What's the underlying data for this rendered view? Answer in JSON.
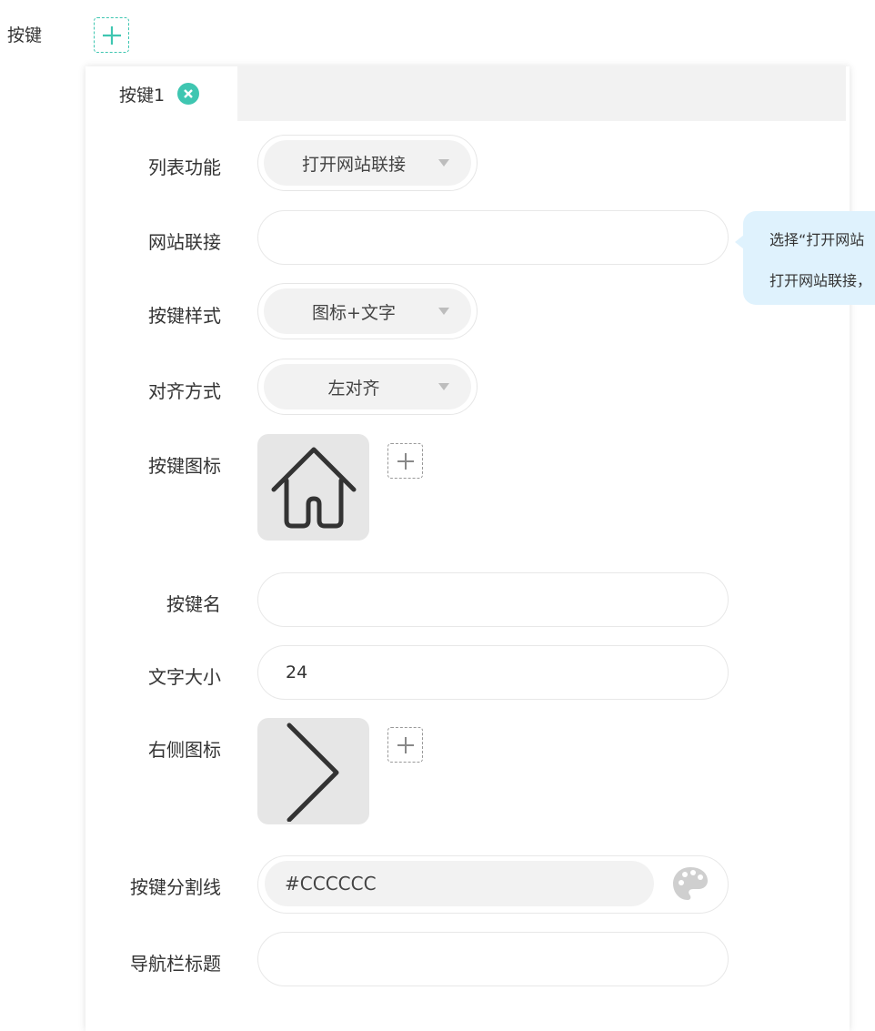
{
  "header": {
    "label": "按键"
  },
  "tabs": [
    {
      "label": "按键1"
    }
  ],
  "form": {
    "list_function": {
      "label": "列表功能",
      "value": "打开网站联接"
    },
    "website_link": {
      "label": "网站联接",
      "value": ""
    },
    "button_style": {
      "label": "按键样式",
      "value": "图标+文字"
    },
    "alignment": {
      "label": "对齐方式",
      "value": "左对齐"
    },
    "button_icon": {
      "label": "按键图标",
      "icon": "home-icon"
    },
    "button_name": {
      "label": "按键名",
      "value": ""
    },
    "font_size": {
      "label": "文字大小",
      "value": "24"
    },
    "right_icon": {
      "label": "右侧图标",
      "icon": "chevron-right-icon"
    },
    "divider": {
      "label": "按键分割线",
      "value": "#CCCCCC"
    },
    "nav_title": {
      "label": "导航栏标题",
      "value": ""
    }
  },
  "tooltip": {
    "line1": "选择“打开网站",
    "line2": "打开网站联接，"
  },
  "colors": {
    "accent": "#3fc6b1",
    "tooltip_bg": "#dff2fd"
  }
}
